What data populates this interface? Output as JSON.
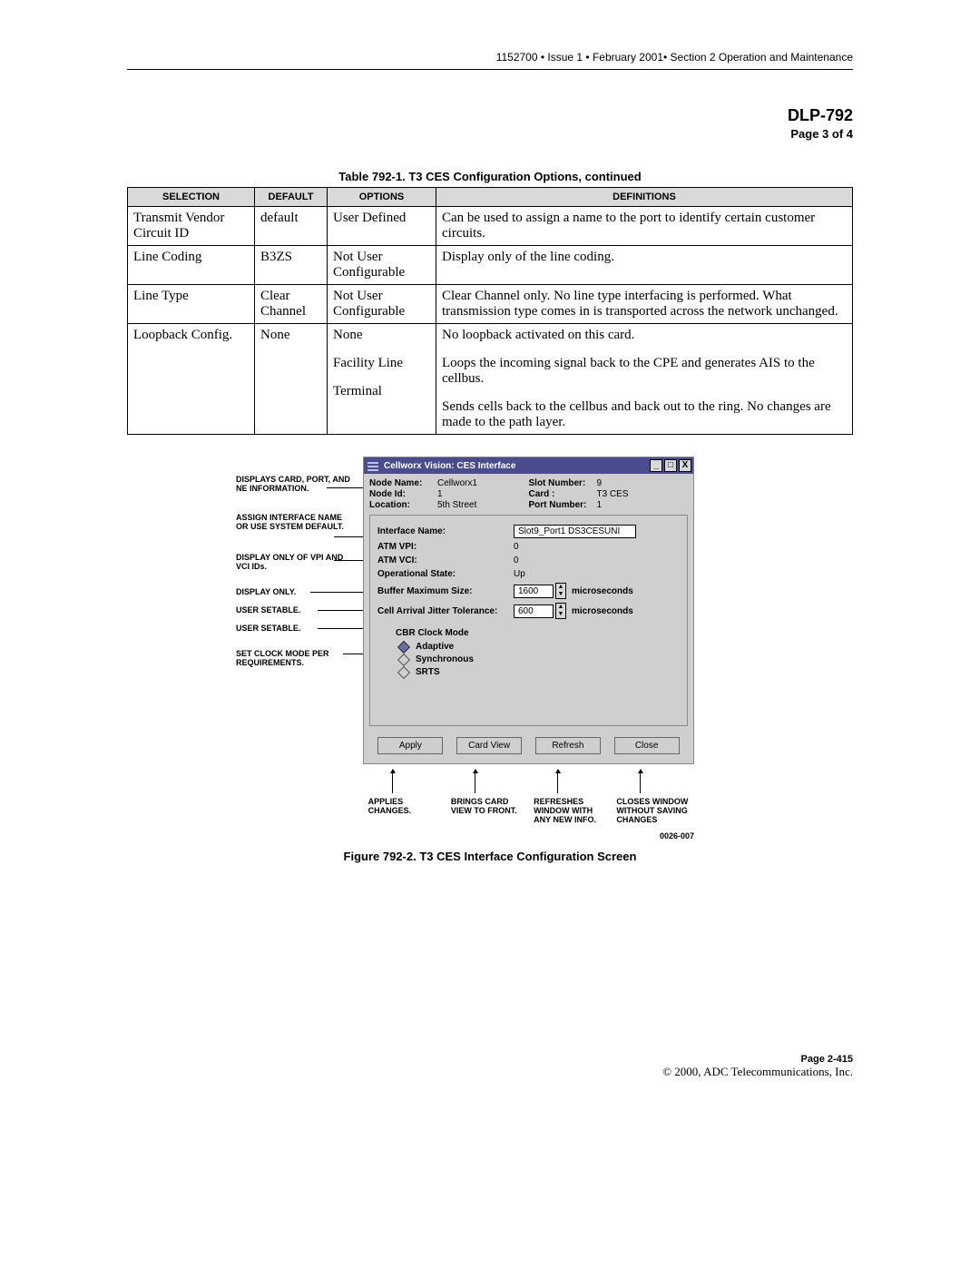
{
  "header_text": "1152700 • Issue 1 • February 2001• Section 2 Operation and Maintenance",
  "dlp_title": "DLP-792",
  "page_of": "Page 3 of 4",
  "table_caption": "Table 792-1. T3 CES Configuration Options, continued",
  "th": {
    "c1": "SELECTION",
    "c2": "DEFAULT",
    "c3": "OPTIONS",
    "c4": "DEFINITIONS"
  },
  "rows": [
    {
      "sel": "Transmit Vendor Circuit ID",
      "def": "default",
      "opt": "User Defined",
      "defn": "Can be used to assign a name to the port to identify certain customer circuits."
    },
    {
      "sel": "Line Coding",
      "def": "B3ZS",
      "opt": "Not User Configurable",
      "defn": "Display only of the line coding."
    },
    {
      "sel": "Line Type",
      "def": "Clear Channel",
      "opt": "Not User Configurable",
      "defn": "Clear Channel only. No line type interfacing is performed. What transmission type comes in is transported across the network unchanged."
    }
  ],
  "loop": {
    "sel": "Loopback Config.",
    "def": "None",
    "opts": [
      "None",
      "Facility Line",
      "Terminal"
    ],
    "defs": [
      "No loopback activated on this card.",
      "Loops the incoming signal back to the CPE and generates AIS to the cellbus.",
      "Sends cells back to the cellbus and back out to the ring. No changes are made to the path layer."
    ]
  },
  "dialog": {
    "title": "Cellworx Vision: CES Interface",
    "min": "_",
    "max": "□",
    "close": "X",
    "node_name_l": "Node Name:",
    "node_name_v": "Cellworx1",
    "node_id_l": "Node Id:",
    "node_id_v": "1",
    "location_l": "Location:",
    "location_v": "5th Street",
    "slot_l": "Slot Number:",
    "slot_v": "9",
    "card_l": "Card :",
    "card_v": "T3 CES",
    "port_l": "Port Number:",
    "port_v": "1",
    "iface_l": "Interface Name:",
    "iface_v": "Slot9_Port1 DS3CESUNI",
    "vpi_l": "ATM VPI:",
    "vpi_v": "0",
    "vci_l": "ATM VCI:",
    "vci_v": "0",
    "ops_l": "Operational State:",
    "ops_v": "Up",
    "buf_l": "Buffer Maximum Size:",
    "buf_v": "1600",
    "buf_u": "microseconds",
    "jit_l": "Cell Arrival Jitter Tolerance:",
    "jit_v": "600",
    "jit_u": "microseconds",
    "clk_hdr": "CBR Clock Mode",
    "clk_opts": [
      "Adaptive",
      "Synchronous",
      "SRTS"
    ],
    "btns": [
      "Apply",
      "Card View",
      "Refresh",
      "Close"
    ]
  },
  "annos": {
    "a1": "DISPLAYS CARD, PORT, AND NE INFORMATION.",
    "a2": "ASSIGN INTERFACE NAME OR USE SYSTEM DEFAULT.",
    "a3": "DISPLAY ONLY OF VPI AND VCI IDs.",
    "a4": "DISPLAY ONLY.",
    "a5": "USER SETABLE.",
    "a6": "USER SETABLE.",
    "a7": "SET CLOCK MODE PER REQUIREMENTS."
  },
  "btn_annos": [
    "APPLIES CHANGES.",
    "BRINGS CARD VIEW TO FRONT.",
    "REFRESHES WINDOW WITH ANY NEW INFO.",
    "CLOSES WINDOW WITHOUT SAVING CHANGES"
  ],
  "fig_no": "0026-007",
  "fig_caption": "Figure  792-2. T3 CES Interface Configuration Screen",
  "footer_page": "Page 2-415",
  "footer_copy": "© 2000, ADC Telecommunications, Inc."
}
